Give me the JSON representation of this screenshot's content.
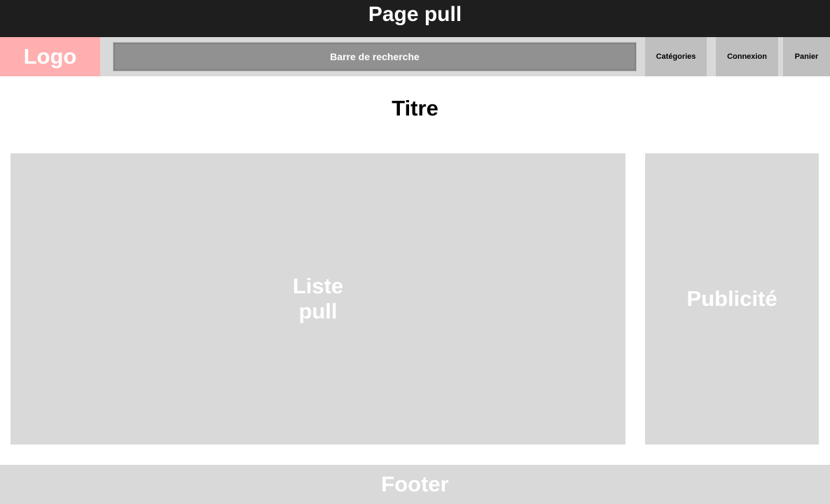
{
  "top_bar": {
    "title": "Page pull"
  },
  "header": {
    "logo": "Logo",
    "search": "Barre de recherche",
    "categories": "Catégories",
    "login": "Connexion",
    "cart": "Panier"
  },
  "main": {
    "title": "Titre",
    "list": "Liste pull",
    "ad": "Publicité"
  },
  "footer": {
    "label": "Footer"
  },
  "colors": {
    "top_bar": "#1e1e1e",
    "logo": "#ffafaf",
    "search": "#919191",
    "nav_button": "#bfbfbf",
    "panel": "#d9d9d9"
  }
}
